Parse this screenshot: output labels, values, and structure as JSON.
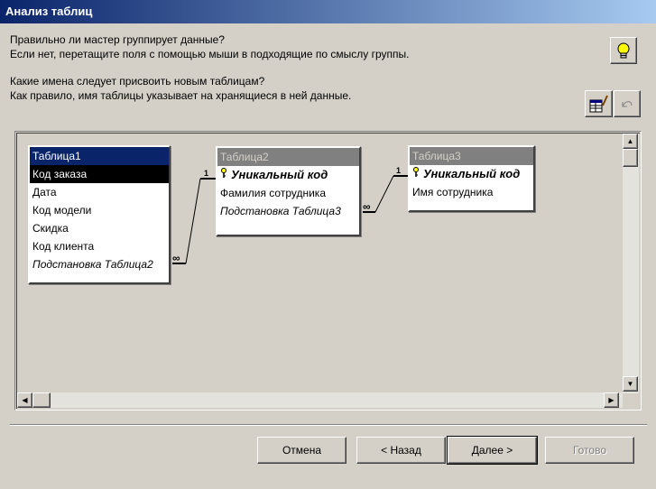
{
  "window": {
    "title": "Анализ таблиц"
  },
  "instructions": {
    "line1": "Правильно ли мастер группирует данные?",
    "line2": "Если нет, перетащите поля с помощью мыши в подходящие по смыслу группы.",
    "line3": "Какие имена следует присвоить новым таблицам?",
    "line4": "Как правило, имя таблицы указывает на хранящиеся в ней данные."
  },
  "toolbar": {
    "tips_icon": "lightbulb-icon",
    "rename_icon": "rename-table-icon",
    "undo_icon": "undo-icon"
  },
  "tables": [
    {
      "name": "Таблица1",
      "fields": [
        "Код заказа",
        "Дата",
        "Код модели",
        "Скидка",
        "Код клиента",
        "Подстановка Таблица2"
      ]
    },
    {
      "name": "Таблица2",
      "fields": [
        "Уникальный код",
        "Фамилия сотрудника",
        "Подстановка Таблица3"
      ]
    },
    {
      "name": "Таблица3",
      "fields": [
        "Уникальный код",
        "Имя сотрудника"
      ]
    }
  ],
  "relations": [
    {
      "one": "1",
      "many": "∞"
    },
    {
      "one": "1",
      "many": "∞"
    }
  ],
  "buttons": {
    "cancel": "Отмена",
    "back": "< Назад",
    "next": "Далее >",
    "finish": "Готово"
  }
}
